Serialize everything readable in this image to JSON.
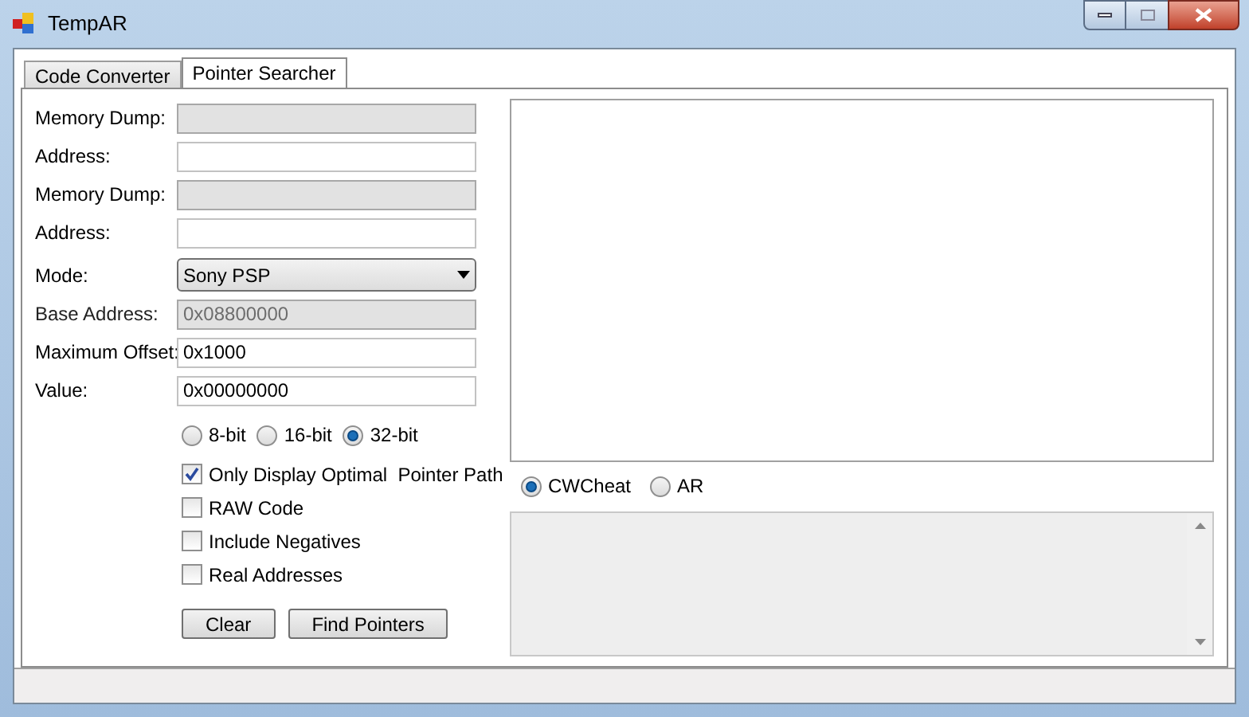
{
  "window": {
    "title": "TempAR"
  },
  "tabs": [
    {
      "label": "Code Converter",
      "selected": false
    },
    {
      "label": "Pointer Searcher",
      "selected": true
    }
  ],
  "fields": [
    {
      "kind": "text",
      "label": "Memory Dump:",
      "disabled": true
    },
    {
      "kind": "text",
      "label": "Address:",
      "disabled": false
    },
    {
      "kind": "text",
      "label": "Memory Dump:",
      "disabled": true
    },
    {
      "kind": "text",
      "label": "Address:",
      "disabled": false
    },
    {
      "kind": "combo",
      "label": "Mode:",
      "value": "Sony PSP"
    },
    {
      "kind": "text",
      "label": "Base Address:",
      "value": "0x08800000",
      "disabled": true
    },
    {
      "kind": "text",
      "label": "Maximum Offset:",
      "value": "0x1000",
      "disabled": false
    },
    {
      "kind": "text",
      "label": "Value:",
      "value": "0x00000000",
      "disabled": false
    }
  ],
  "bit_options": [
    {
      "label": "8-bit",
      "selected": false
    },
    {
      "label": "16-bit",
      "selected": false
    },
    {
      "label": "32-bit",
      "selected": true
    }
  ],
  "checkboxes": [
    {
      "label": "Only Display Optimal  Pointer Path",
      "checked": true
    },
    {
      "label": "RAW Code",
      "checked": false
    },
    {
      "label": "Include Negatives",
      "checked": false
    },
    {
      "label": "Real Addresses",
      "checked": false
    }
  ],
  "buttons": [
    "Clear",
    "Find Pointers"
  ],
  "code_format": [
    {
      "label": "CWCheat",
      "selected": true
    },
    {
      "label": "AR",
      "selected": false
    }
  ]
}
